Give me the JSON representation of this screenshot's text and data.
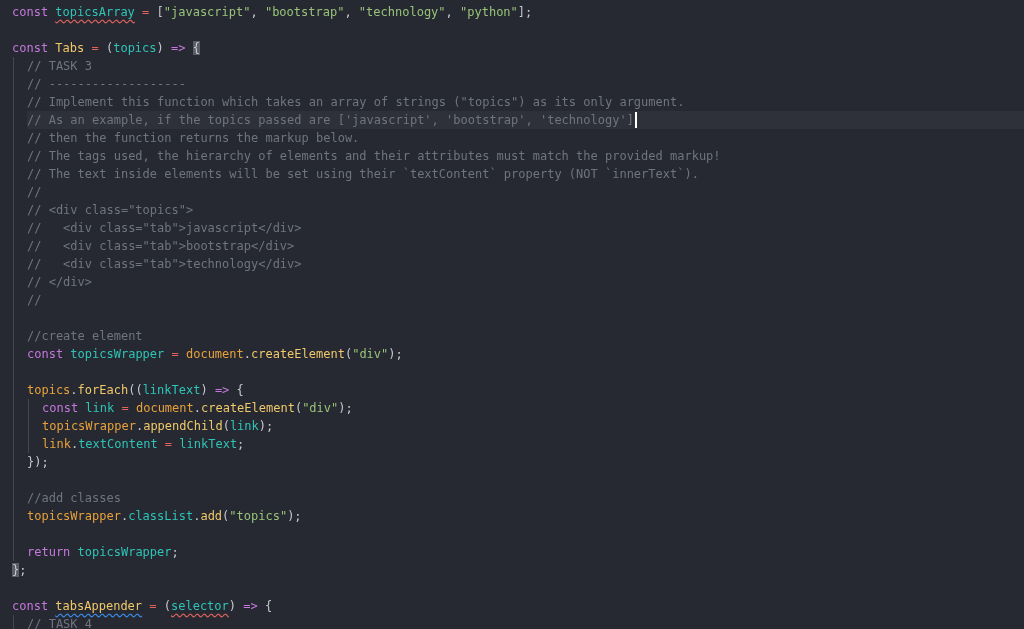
{
  "editor": {
    "lines": [
      {
        "kind": "code",
        "tokens": [
          {
            "text": "const ",
            "kind": "keyword"
          },
          {
            "text": "topicsArray",
            "kind": "variable",
            "error": true
          },
          {
            "text": " = ",
            "kind": "operator"
          },
          {
            "text": "[",
            "kind": "punct"
          },
          {
            "text": "\"javascript\"",
            "kind": "string"
          },
          {
            "text": ", ",
            "kind": "punct"
          },
          {
            "text": "\"bootstrap\"",
            "kind": "string"
          },
          {
            "text": ", ",
            "kind": "punct"
          },
          {
            "text": "\"technology\"",
            "kind": "string"
          },
          {
            "text": ", ",
            "kind": "punct"
          },
          {
            "text": "\"python\"",
            "kind": "string"
          },
          {
            "text": "];",
            "kind": "punct"
          }
        ]
      },
      {
        "kind": "blank"
      },
      {
        "kind": "code",
        "tokens": [
          {
            "text": "const ",
            "kind": "keyword"
          },
          {
            "text": "Tabs",
            "kind": "name"
          },
          {
            "text": " = ",
            "kind": "operator"
          },
          {
            "text": "(",
            "kind": "punct"
          },
          {
            "text": "topics",
            "kind": "variable"
          },
          {
            "text": ") ",
            "kind": "punct"
          },
          {
            "text": "=> ",
            "kind": "keyword"
          },
          {
            "text": "{",
            "kind": "punct",
            "matched": true
          }
        ],
        "children": [
          {
            "kind": "code",
            "tokens": [
              {
                "text": "// TASK 3",
                "kind": "comment"
              }
            ]
          },
          {
            "kind": "code",
            "tokens": [
              {
                "text": "// -------------------",
                "kind": "comment"
              }
            ]
          },
          {
            "kind": "code",
            "tokens": [
              {
                "text": "// Implement this function which takes an array of strings (\"topics\") as its only argument.",
                "kind": "comment"
              }
            ]
          },
          {
            "kind": "code",
            "cursor": true,
            "tokens": [
              {
                "text": "// As an example, if the topics passed are ['javascript', 'bootstrap', 'technology']",
                "kind": "comment"
              }
            ]
          },
          {
            "kind": "code",
            "tokens": [
              {
                "text": "// then the function returns the markup below.",
                "kind": "comment"
              }
            ]
          },
          {
            "kind": "code",
            "tokens": [
              {
                "text": "// The tags used, the hierarchy of elements and their attributes must match the provided markup!",
                "kind": "comment"
              }
            ]
          },
          {
            "kind": "code",
            "tokens": [
              {
                "text": "// The text inside elements will be set using their `textContent` property (NOT `innerText`).",
                "kind": "comment"
              }
            ]
          },
          {
            "kind": "code",
            "tokens": [
              {
                "text": "//",
                "kind": "comment"
              }
            ]
          },
          {
            "kind": "code",
            "tokens": [
              {
                "text": "// <div class=\"topics\">",
                "kind": "comment"
              }
            ]
          },
          {
            "kind": "code",
            "tokens": [
              {
                "text": "//   <div class=\"tab\">javascript</div>",
                "kind": "comment"
              }
            ]
          },
          {
            "kind": "code",
            "tokens": [
              {
                "text": "//   <div class=\"tab\">bootstrap</div>",
                "kind": "comment"
              }
            ]
          },
          {
            "kind": "code",
            "tokens": [
              {
                "text": "//   <div class=\"tab\">technology</div>",
                "kind": "comment"
              }
            ]
          },
          {
            "kind": "code",
            "tokens": [
              {
                "text": "// </div>",
                "kind": "comment"
              }
            ]
          },
          {
            "kind": "code",
            "tokens": [
              {
                "text": "//",
                "kind": "comment"
              }
            ]
          },
          {
            "kind": "blank"
          },
          {
            "kind": "code",
            "tokens": [
              {
                "text": "//create element",
                "kind": "comment"
              }
            ]
          },
          {
            "kind": "code",
            "tokens": [
              {
                "text": "const ",
                "kind": "keyword"
              },
              {
                "text": "topicsWrapper",
                "kind": "variable"
              },
              {
                "text": " = ",
                "kind": "operator"
              },
              {
                "text": "document",
                "kind": "object"
              },
              {
                "text": ".",
                "kind": "punct"
              },
              {
                "text": "createElement",
                "kind": "name"
              },
              {
                "text": "(",
                "kind": "punct"
              },
              {
                "text": "\"div\"",
                "kind": "string"
              },
              {
                "text": ");",
                "kind": "punct"
              }
            ]
          },
          {
            "kind": "blank"
          },
          {
            "kind": "code",
            "tokens": [
              {
                "text": "topics",
                "kind": "object"
              },
              {
                "text": ".",
                "kind": "punct"
              },
              {
                "text": "forEach",
                "kind": "name"
              },
              {
                "text": "((",
                "kind": "punct"
              },
              {
                "text": "linkText",
                "kind": "variable"
              },
              {
                "text": ") ",
                "kind": "punct"
              },
              {
                "text": "=>",
                "kind": "keyword"
              },
              {
                "text": " {",
                "kind": "punct"
              }
            ],
            "children": [
              {
                "kind": "code",
                "tokens": [
                  {
                    "text": "const ",
                    "kind": "keyword"
                  },
                  {
                    "text": "link",
                    "kind": "variable"
                  },
                  {
                    "text": " = ",
                    "kind": "operator"
                  },
                  {
                    "text": "document",
                    "kind": "object"
                  },
                  {
                    "text": ".",
                    "kind": "punct"
                  },
                  {
                    "text": "createElement",
                    "kind": "name"
                  },
                  {
                    "text": "(",
                    "kind": "punct"
                  },
                  {
                    "text": "\"div\"",
                    "kind": "string"
                  },
                  {
                    "text": ");",
                    "kind": "punct"
                  }
                ]
              },
              {
                "kind": "code",
                "tokens": [
                  {
                    "text": "topicsWrapper",
                    "kind": "object"
                  },
                  {
                    "text": ".",
                    "kind": "punct"
                  },
                  {
                    "text": "appendChild",
                    "kind": "name"
                  },
                  {
                    "text": "(",
                    "kind": "punct"
                  },
                  {
                    "text": "link",
                    "kind": "variable"
                  },
                  {
                    "text": ");",
                    "kind": "punct"
                  }
                ]
              },
              {
                "kind": "code",
                "tokens": [
                  {
                    "text": "link",
                    "kind": "object"
                  },
                  {
                    "text": ".",
                    "kind": "punct"
                  },
                  {
                    "text": "textContent",
                    "kind": "variable"
                  },
                  {
                    "text": " = ",
                    "kind": "operator"
                  },
                  {
                    "text": "linkText",
                    "kind": "variable"
                  },
                  {
                    "text": ";",
                    "kind": "punct"
                  }
                ]
              }
            ]
          },
          {
            "kind": "code",
            "tokens": [
              {
                "text": "});",
                "kind": "punct"
              }
            ]
          },
          {
            "kind": "blank"
          },
          {
            "kind": "code",
            "tokens": [
              {
                "text": "//add classes",
                "kind": "comment"
              }
            ]
          },
          {
            "kind": "code",
            "tokens": [
              {
                "text": "topicsWrapper",
                "kind": "object"
              },
              {
                "text": ".",
                "kind": "punct"
              },
              {
                "text": "classList",
                "kind": "variable"
              },
              {
                "text": ".",
                "kind": "punct"
              },
              {
                "text": "add",
                "kind": "name"
              },
              {
                "text": "(",
                "kind": "punct"
              },
              {
                "text": "\"topics\"",
                "kind": "string"
              },
              {
                "text": ");",
                "kind": "punct"
              }
            ]
          },
          {
            "kind": "blank"
          },
          {
            "kind": "code",
            "tokens": [
              {
                "text": "return ",
                "kind": "keyword"
              },
              {
                "text": "topicsWrapper",
                "kind": "variable"
              },
              {
                "text": ";",
                "kind": "punct"
              }
            ]
          }
        ]
      },
      {
        "kind": "code",
        "tokens": [
          {
            "text": "}",
            "kind": "punct",
            "matched": true
          },
          {
            "text": ";",
            "kind": "punct"
          }
        ]
      },
      {
        "kind": "blank"
      },
      {
        "kind": "code",
        "tokens": [
          {
            "text": "const ",
            "kind": "keyword"
          },
          {
            "text": "tabsAppender",
            "kind": "name",
            "warning": true
          },
          {
            "text": " = ",
            "kind": "operator"
          },
          {
            "text": "(",
            "kind": "punct"
          },
          {
            "text": "selector",
            "kind": "variable",
            "error": true
          },
          {
            "text": ") ",
            "kind": "punct"
          },
          {
            "text": "=>",
            "kind": "keyword"
          },
          {
            "text": " {",
            "kind": "punct"
          }
        ],
        "children": [
          {
            "kind": "code",
            "tokens": [
              {
                "text": "// TASK 4",
                "kind": "comment"
              }
            ]
          }
        ]
      }
    ]
  }
}
